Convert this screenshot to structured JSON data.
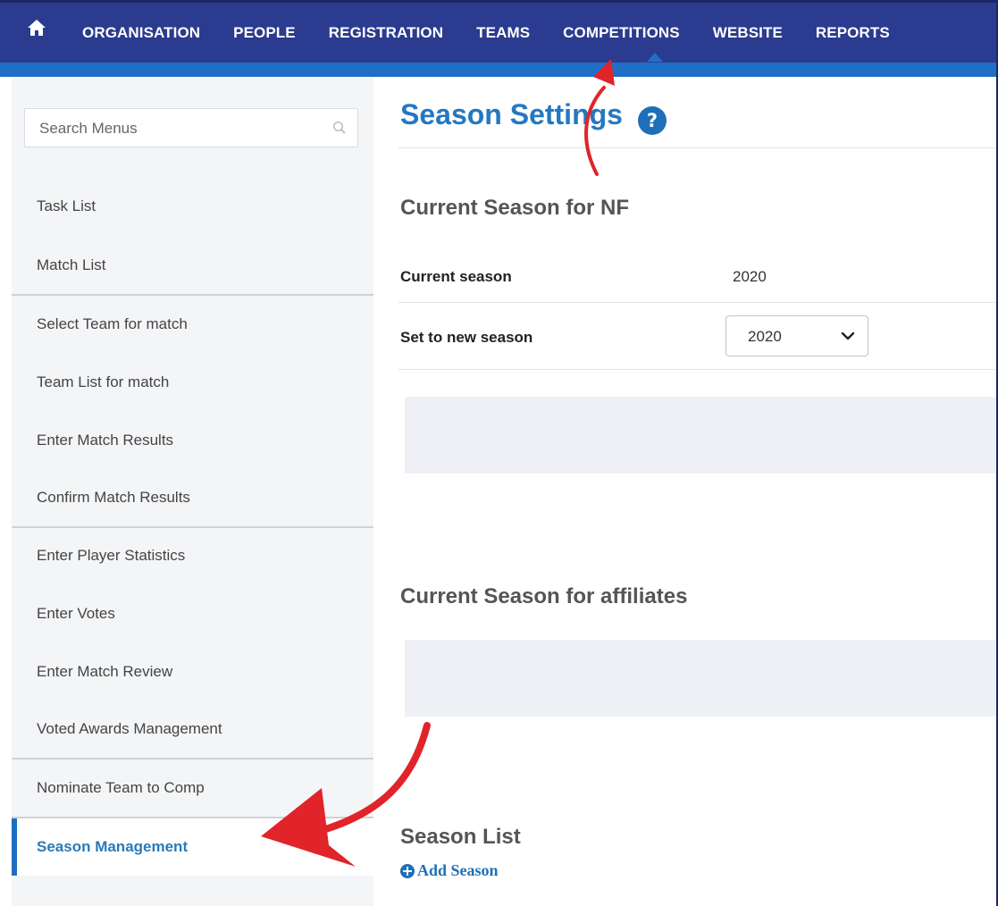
{
  "nav": {
    "items": [
      "ORGANISATION",
      "PEOPLE",
      "REGISTRATION",
      "TEAMS",
      "COMPETITIONS",
      "WEBSITE",
      "REPORTS"
    ]
  },
  "sidebar": {
    "search_placeholder": "Search Menus",
    "items": [
      {
        "label": "Task List"
      },
      {
        "label": "Match List"
      },
      {
        "label": "Select Team for match"
      },
      {
        "label": "Team List for match"
      },
      {
        "label": "Enter Match Results"
      },
      {
        "label": "Confirm Match Results"
      },
      {
        "label": "Enter Player Statistics"
      },
      {
        "label": "Enter Votes"
      },
      {
        "label": "Enter Match Review"
      },
      {
        "label": "Voted Awards Management"
      },
      {
        "label": "Nominate Team to Comp"
      },
      {
        "label": "Season Management"
      }
    ],
    "active_item": "Season Management"
  },
  "main": {
    "title": "Season Settings",
    "current_nf_heading": "Current Season for NF",
    "current_season_label": "Current season",
    "current_season_value": "2020",
    "new_season_label": "Set to new season",
    "new_season_selected": "2020",
    "affiliates_heading": "Current Season for affiliates",
    "season_list_heading": "Season List",
    "add_season_label": "Add Season"
  },
  "colors": {
    "nav_bg": "#2b3b8f",
    "nav_stripe": "#1f6fc4",
    "title_blue": "#2478c2",
    "annotation_red": "#e0242a"
  }
}
